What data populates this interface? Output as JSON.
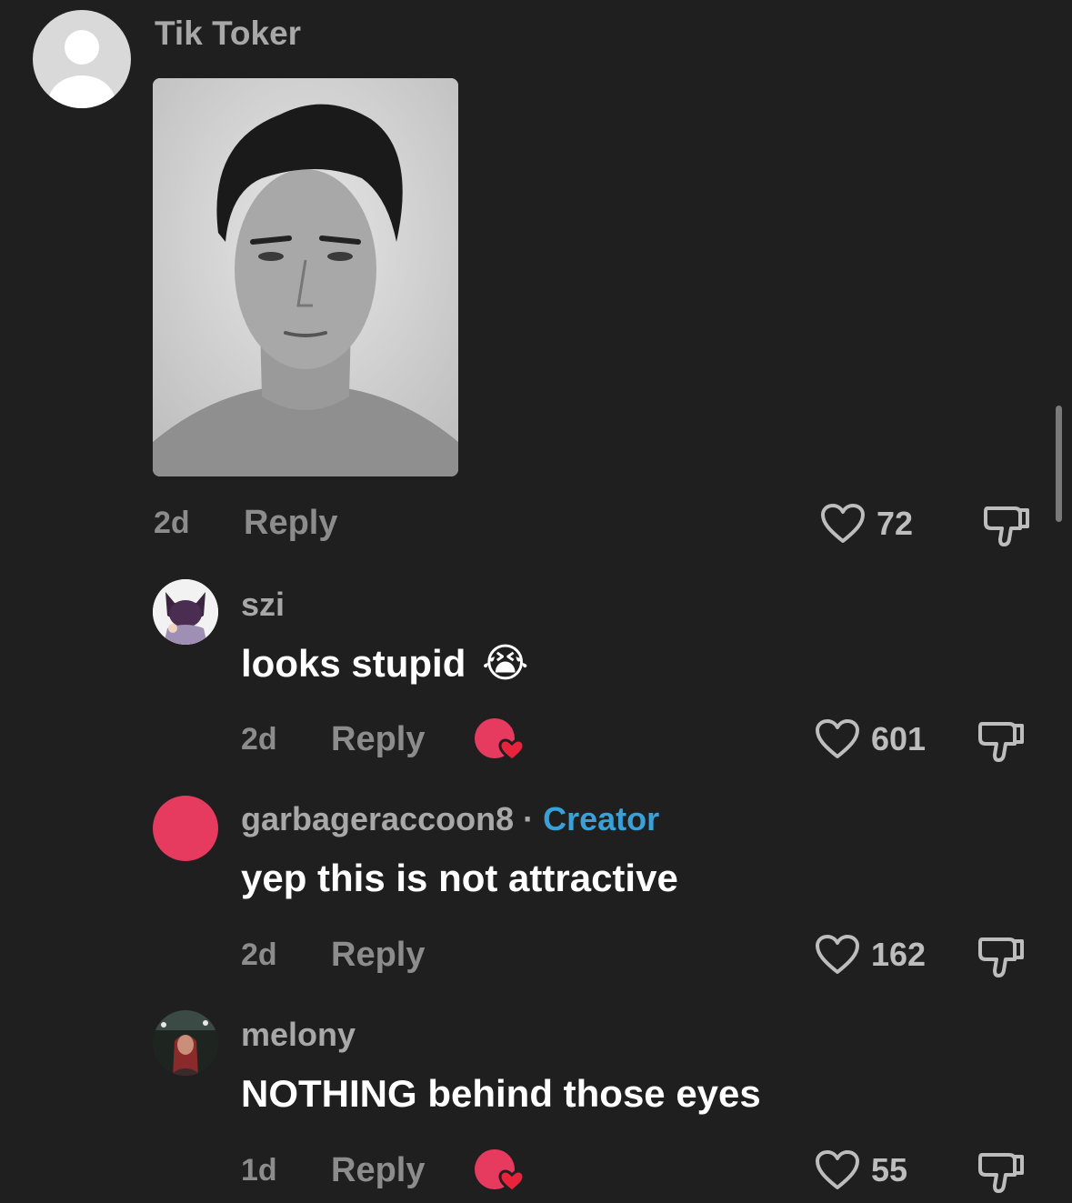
{
  "post": {
    "author": "Tik Toker",
    "time": "2d",
    "reply_label": "Reply",
    "likes": "72"
  },
  "comments": [
    {
      "username": "szi",
      "text": "looks stupid",
      "emoji": "😭",
      "time": "2d",
      "reply_label": "Reply",
      "likes": "601",
      "liked_by_creator": true
    },
    {
      "username": "garbageraccoon8",
      "separator": "·",
      "badge": "Creator",
      "text": "yep this is not attractive",
      "time": "2d",
      "reply_label": "Reply",
      "likes": "162",
      "liked_by_creator": false
    },
    {
      "username": "melony",
      "text": "NOTHING behind those eyes",
      "time": "1d",
      "reply_label": "Reply",
      "likes": "55",
      "liked_by_creator": true
    }
  ],
  "icons": {
    "like": "heart-outline-icon",
    "dislike": "thumbs-down-icon",
    "creator_liked": "creator-liked-heart-icon"
  },
  "colors": {
    "background": "#1f1f1f",
    "creator_badge": "#3aa0d8",
    "accent_pink": "#e63b5f"
  }
}
